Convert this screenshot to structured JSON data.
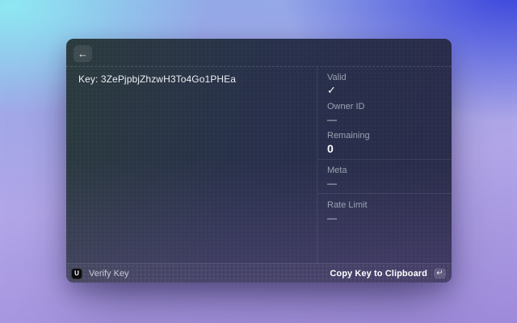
{
  "titlebar": {
    "back_glyph": "←"
  },
  "main": {
    "key_text": "Key: 3ZePjpbjZhzwH3To4Go1PHEa"
  },
  "panel": {
    "sections": [
      {
        "items": [
          {
            "label": "Valid",
            "value": "✓"
          },
          {
            "label": "Owner ID",
            "value": "—"
          },
          {
            "label": "Remaining",
            "value": "0"
          }
        ]
      },
      {
        "items": [
          {
            "label": "Meta",
            "value": "—"
          }
        ]
      },
      {
        "items": [
          {
            "label": "Rate Limit",
            "value": "—"
          }
        ]
      }
    ]
  },
  "footer": {
    "logo_glyph": "U",
    "verify_label": "Verify Key",
    "copy_label": "Copy Key to Clipboard",
    "enter_glyph": "↵"
  },
  "colors": {
    "accent_blue": "#3a44dc",
    "bg_cyan": "#8ee8f2",
    "bg_purple": "#9e8ada",
    "check_color": "#ffffff"
  }
}
